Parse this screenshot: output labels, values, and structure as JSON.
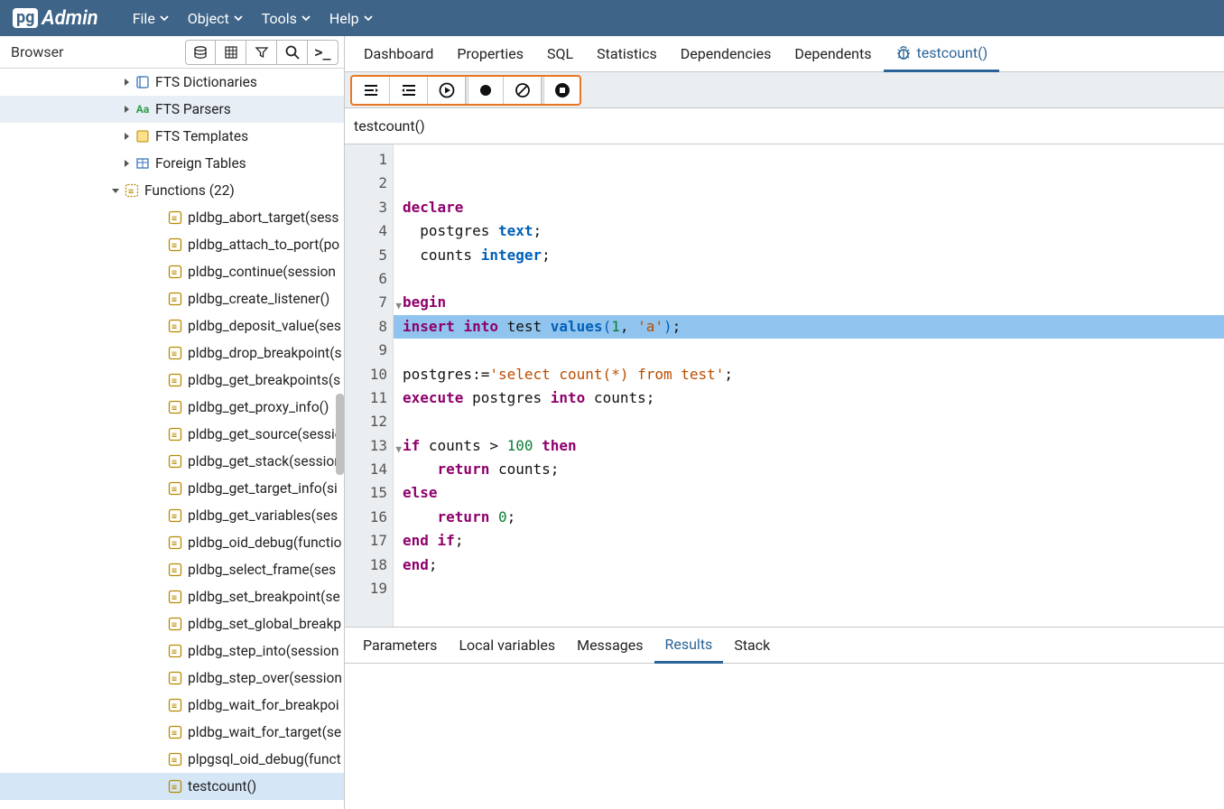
{
  "brand": {
    "pg": "pg",
    "admin": "Admin"
  },
  "menubar": [
    "File",
    "Object",
    "Tools",
    "Help"
  ],
  "sidebar": {
    "title": "Browser",
    "nodes": [
      {
        "indent": 132,
        "chev": "right",
        "icon": "fts-dict",
        "label": "FTS Dictionaries"
      },
      {
        "indent": 132,
        "chev": "right",
        "icon": "fts-parser",
        "label": "FTS Parsers",
        "selected": true
      },
      {
        "indent": 132,
        "chev": "right",
        "icon": "fts-tpl",
        "label": "FTS Templates"
      },
      {
        "indent": 132,
        "chev": "right",
        "icon": "table",
        "label": "Foreign Tables"
      },
      {
        "indent": 120,
        "chev": "down",
        "icon": "func-group",
        "label": "Functions (22)"
      },
      {
        "indent": 168,
        "chev": "",
        "icon": "func",
        "label": "pldbg_abort_target(sess"
      },
      {
        "indent": 168,
        "chev": "",
        "icon": "func",
        "label": "pldbg_attach_to_port(po"
      },
      {
        "indent": 168,
        "chev": "",
        "icon": "func",
        "label": "pldbg_continue(session"
      },
      {
        "indent": 168,
        "chev": "",
        "icon": "func",
        "label": "pldbg_create_listener()"
      },
      {
        "indent": 168,
        "chev": "",
        "icon": "func",
        "label": "pldbg_deposit_value(ses"
      },
      {
        "indent": 168,
        "chev": "",
        "icon": "func",
        "label": "pldbg_drop_breakpoint(s"
      },
      {
        "indent": 168,
        "chev": "",
        "icon": "func",
        "label": "pldbg_get_breakpoints(s"
      },
      {
        "indent": 168,
        "chev": "",
        "icon": "func",
        "label": "pldbg_get_proxy_info()"
      },
      {
        "indent": 168,
        "chev": "",
        "icon": "func",
        "label": "pldbg_get_source(sessio"
      },
      {
        "indent": 168,
        "chev": "",
        "icon": "func",
        "label": "pldbg_get_stack(session"
      },
      {
        "indent": 168,
        "chev": "",
        "icon": "func",
        "label": "pldbg_get_target_info(si"
      },
      {
        "indent": 168,
        "chev": "",
        "icon": "func",
        "label": "pldbg_get_variables(ses"
      },
      {
        "indent": 168,
        "chev": "",
        "icon": "func",
        "label": "pldbg_oid_debug(functio"
      },
      {
        "indent": 168,
        "chev": "",
        "icon": "func",
        "label": "pldbg_select_frame(ses"
      },
      {
        "indent": 168,
        "chev": "",
        "icon": "func",
        "label": "pldbg_set_breakpoint(se"
      },
      {
        "indent": 168,
        "chev": "",
        "icon": "func",
        "label": "pldbg_set_global_breakp"
      },
      {
        "indent": 168,
        "chev": "",
        "icon": "func",
        "label": "pldbg_step_into(session"
      },
      {
        "indent": 168,
        "chev": "",
        "icon": "func",
        "label": "pldbg_step_over(session"
      },
      {
        "indent": 168,
        "chev": "",
        "icon": "func",
        "label": "pldbg_wait_for_breakpoi"
      },
      {
        "indent": 168,
        "chev": "",
        "icon": "func",
        "label": "pldbg_wait_for_target(se"
      },
      {
        "indent": 168,
        "chev": "",
        "icon": "func",
        "label": "plpgsql_oid_debug(funct"
      },
      {
        "indent": 168,
        "chev": "",
        "icon": "func",
        "label": "testcount()",
        "active": true
      }
    ]
  },
  "rtabs": [
    {
      "label": "Dashboard"
    },
    {
      "label": "Properties"
    },
    {
      "label": "SQL"
    },
    {
      "label": "Statistics"
    },
    {
      "label": "Dependencies"
    },
    {
      "label": "Dependents"
    },
    {
      "label": "testcount()",
      "active": true,
      "icon": "bug"
    }
  ],
  "tabline": "testcount()",
  "code": {
    "lines": [
      {
        "n": 1,
        "tokens": []
      },
      {
        "n": 2,
        "tokens": []
      },
      {
        "n": 3,
        "tokens": [
          {
            "t": "declare",
            "c": "kw"
          }
        ]
      },
      {
        "n": 4,
        "tokens": [
          {
            "t": "  postgres ",
            "c": ""
          },
          {
            "t": "text",
            "c": "ty"
          },
          {
            "t": ";",
            "c": ""
          }
        ]
      },
      {
        "n": 5,
        "tokens": [
          {
            "t": "  counts ",
            "c": ""
          },
          {
            "t": "integer",
            "c": "ty"
          },
          {
            "t": ";",
            "c": ""
          }
        ]
      },
      {
        "n": 6,
        "tokens": []
      },
      {
        "n": 7,
        "fold": true,
        "tokens": [
          {
            "t": "begin",
            "c": "kw"
          }
        ]
      },
      {
        "n": 8,
        "hl": true,
        "tokens": [
          {
            "t": "insert",
            "c": "kw"
          },
          {
            "t": " ",
            "c": ""
          },
          {
            "t": "into",
            "c": "kw"
          },
          {
            "t": " test ",
            "c": ""
          },
          {
            "t": "values",
            "c": "id2"
          },
          {
            "t": "(",
            "c": "pn"
          },
          {
            "t": "1",
            "c": "nu"
          },
          {
            "t": ", ",
            "c": ""
          },
          {
            "t": "'a'",
            "c": "st"
          },
          {
            "t": ")",
            "c": "pn"
          },
          {
            "t": ";",
            "c": ""
          }
        ]
      },
      {
        "n": 9,
        "tokens": []
      },
      {
        "n": 10,
        "tokens": [
          {
            "t": "postgres:=",
            "c": ""
          },
          {
            "t": "'select count(*) from test'",
            "c": "st"
          },
          {
            "t": ";",
            "c": ""
          }
        ]
      },
      {
        "n": 11,
        "tokens": [
          {
            "t": "execute",
            "c": "kw"
          },
          {
            "t": " postgres ",
            "c": ""
          },
          {
            "t": "into",
            "c": "kw"
          },
          {
            "t": " counts;",
            "c": ""
          }
        ]
      },
      {
        "n": 12,
        "tokens": []
      },
      {
        "n": 13,
        "fold": true,
        "tokens": [
          {
            "t": "if",
            "c": "kw"
          },
          {
            "t": " counts > ",
            "c": ""
          },
          {
            "t": "100",
            "c": "nu"
          },
          {
            "t": " ",
            "c": ""
          },
          {
            "t": "then",
            "c": "kw"
          }
        ]
      },
      {
        "n": 14,
        "tokens": [
          {
            "t": "    ",
            "c": ""
          },
          {
            "t": "return",
            "c": "kw"
          },
          {
            "t": " counts;",
            "c": ""
          }
        ]
      },
      {
        "n": 15,
        "tokens": [
          {
            "t": "else",
            "c": "kw"
          }
        ]
      },
      {
        "n": 16,
        "tokens": [
          {
            "t": "    ",
            "c": ""
          },
          {
            "t": "return",
            "c": "kw"
          },
          {
            "t": " ",
            "c": ""
          },
          {
            "t": "0",
            "c": "nu"
          },
          {
            "t": ";",
            "c": ""
          }
        ]
      },
      {
        "n": 17,
        "tokens": [
          {
            "t": "end",
            "c": "kw"
          },
          {
            "t": " ",
            "c": ""
          },
          {
            "t": "if",
            "c": "kw"
          },
          {
            "t": ";",
            "c": ""
          }
        ]
      },
      {
        "n": 18,
        "tokens": [
          {
            "t": "end",
            "c": "kw"
          },
          {
            "t": ";",
            "c": ""
          }
        ]
      },
      {
        "n": 19,
        "tokens": []
      }
    ]
  },
  "bottomtabs": [
    {
      "label": "Parameters"
    },
    {
      "label": "Local variables"
    },
    {
      "label": "Messages"
    },
    {
      "label": "Results",
      "active": true
    },
    {
      "label": "Stack"
    }
  ]
}
